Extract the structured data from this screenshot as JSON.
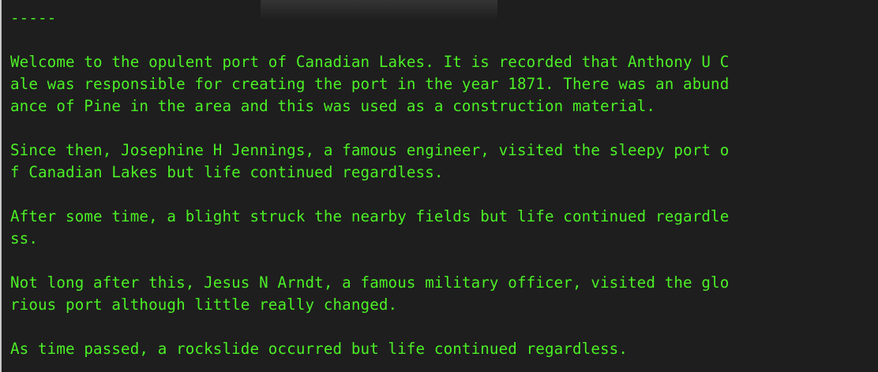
{
  "terminal": {
    "lines": [
      "-----",
      "",
      "Welcome to the opulent port of Canadian Lakes. It is recorded that Anthony U C",
      "ale was responsible for creating the port in the year 1871. There was an abund",
      "ance of Pine in the area and this was used as a construction material.",
      "",
      "Since then, Josephine H Jennings, a famous engineer, visited the sleepy port o",
      "f Canadian Lakes but life continued regardless.",
      "",
      "After some time, a blight struck the nearby fields but life continued regardle",
      "ss.",
      "",
      "Not long after this, Jesus N Arndt, a famous military officer, visited the glo",
      "rious port although little really changed.",
      "",
      "As time passed, a rockslide occurred but life continued regardless."
    ]
  },
  "colors": {
    "background": "#1e1e1e",
    "text": "#4cf026"
  }
}
